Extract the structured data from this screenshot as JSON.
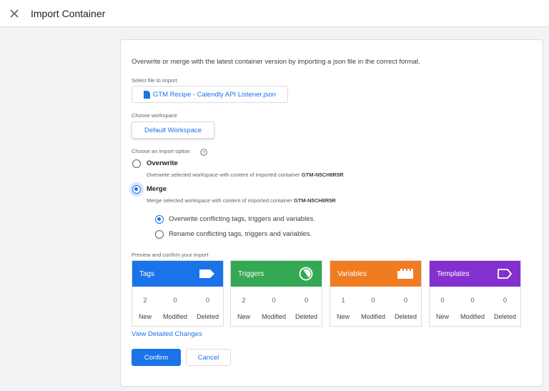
{
  "header": {
    "title": "Import Container"
  },
  "intro": "Overwrite or merge with the latest container version by importing a json file in the correct format.",
  "file": {
    "label": "Select file to import",
    "name": "GTM Recipe - Calendly API Listener.json"
  },
  "workspace": {
    "label": "Choose workspace",
    "value": "Default Workspace"
  },
  "import_option": {
    "label": "Choose an import option",
    "overwrite": {
      "title": "Overwrite",
      "desc_prefix": "Overwrite selected workspace with content of imported container ",
      "container_id": "GTM-N5CH8R5R"
    },
    "merge": {
      "title": "Merge",
      "desc_prefix": "Merge selected workspace with content of imported container ",
      "container_id": "GTM-N5CH8R5R"
    },
    "selected": "Merge",
    "merge_options": [
      {
        "label": "Overwrite conflicting tags, triggers and variables.",
        "selected": true
      },
      {
        "label": "Rename conflicting tags, triggers and variables.",
        "selected": false
      }
    ]
  },
  "preview": {
    "label": "Preview and confirm your import",
    "cards": [
      {
        "name": "Tags",
        "color": "#1a73e8",
        "icon": "tag-icon",
        "new": "2",
        "modified": "0",
        "deleted": "0"
      },
      {
        "name": "Triggers",
        "color": "#34a853",
        "icon": "trigger-icon",
        "new": "2",
        "modified": "0",
        "deleted": "0"
      },
      {
        "name": "Variables",
        "color": "#f07c22",
        "icon": "variables-icon",
        "new": "1",
        "modified": "0",
        "deleted": "0"
      },
      {
        "name": "Templates",
        "color": "#8430ce",
        "icon": "templates-icon",
        "new": "0",
        "modified": "0",
        "deleted": "0"
      }
    ],
    "col_labels": {
      "new": "New",
      "modified": "Modified",
      "deleted": "Deleted"
    }
  },
  "view_changes": "View Detailed Changes",
  "buttons": {
    "confirm": "Confirm",
    "cancel": "Cancel"
  }
}
